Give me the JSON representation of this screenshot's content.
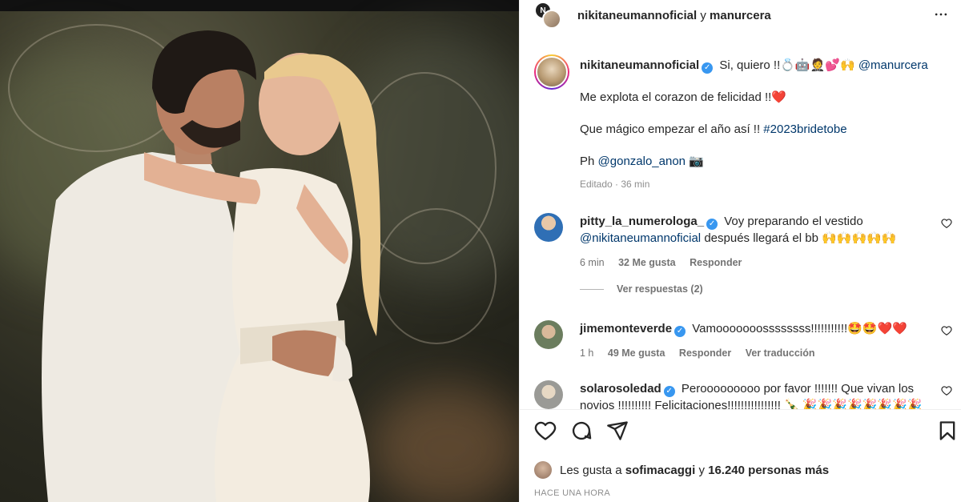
{
  "header": {
    "user1": "nikitaneumannoficial",
    "connector": "y",
    "user2": "manurcera",
    "more_icon": "more-horizontal-icon"
  },
  "caption": {
    "username": "nikitaneumannoficial",
    "line1_text": "Si, quiero !!💍🤖🤵💕🙌",
    "line1_mention": "@manurcera",
    "line2": "Me explota el corazon de felicidad !!❤️",
    "line3_text": "Que mágico empezar el año así !!",
    "line3_hashtag": "#2023bridetobe",
    "line4_text": "Ph",
    "line4_mention": "@gonzalo_anon",
    "line4_emoji": "📷",
    "meta": "Editado · 36 min"
  },
  "comments": [
    {
      "username": "pitty_la_numerologa_",
      "text1": "Voy preparando el vestido",
      "mention": "@nikitaneumannoficial",
      "text2": "después llegará el bb 🙌🙌🙌🙌🙌",
      "time": "6 min",
      "likes": "32 Me gusta",
      "reply": "Responder"
    },
    {
      "username": "jimemonteverde",
      "text": "Vamooooooossssssss!!!!!!!!!!!🤩🤩❤️❤️",
      "time": "1 h",
      "likes": "49 Me gusta",
      "reply": "Responder",
      "translate": "Ver traducción"
    },
    {
      "username": "solarosoledad",
      "text": "Perooooooooo por favor !!!!!!! Que vivan los novios !!!!!!!!!! Felicitaciones!!!!!!!!!!!!!!!! 🍾 🎉🎉🎉🎉🎉🎉🎉🎉"
    }
  ],
  "replies_label": "Ver respuestas (2)",
  "likes": {
    "prefix": "Les gusta a",
    "user": "sofimacaggi",
    "conj": "y",
    "count": "16.240 personas más"
  },
  "timeago": "HACE UNA HORA",
  "colors": {
    "link": "#00376b",
    "verified": "#3897f0",
    "muted": "#737373",
    "heart": "#ed4956"
  }
}
